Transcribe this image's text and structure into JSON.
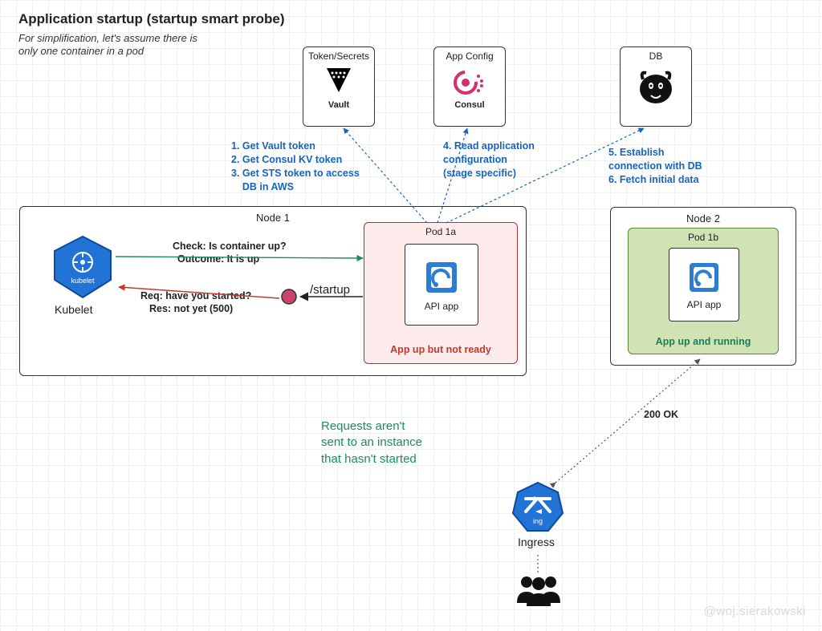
{
  "title": "Application startup (startup smart probe)",
  "subtitle_l1": "For simplification, let's assume there is",
  "subtitle_l2": "only one container in a pod",
  "services": {
    "vault": {
      "title": "Token/Secrets",
      "name": "Vault"
    },
    "consul": {
      "title": "App Config",
      "name": "Consul"
    },
    "db": {
      "title": "DB",
      "name": "PostgreSQL"
    }
  },
  "steps": {
    "vault": [
      "1. Get Vault token",
      "2. Get Consul KV token",
      "3. Get STS token to access",
      "    DB in AWS"
    ],
    "consul": [
      "4. Read application",
      "configuration",
      "(stage specific)"
    ],
    "db": [
      "5. Establish",
      "connection with DB",
      "6. Fetch initial data"
    ]
  },
  "node1": {
    "label": "Node 1",
    "kubelet": "Kubelet",
    "kubelet_badge": "kubelet",
    "check_l1": "Check: Is container up?",
    "check_l2": "Outcome: It is up",
    "probe_l1": "Req: have you started?",
    "probe_l2": "Res: not yet (500)",
    "endpoint": "/startup",
    "pod": {
      "title": "Pod 1a",
      "app": "API app",
      "status": "App up but not ready"
    }
  },
  "node2": {
    "label": "Node 2",
    "pod": {
      "title": "Pod 1b",
      "app": "API app",
      "status": "App up and running"
    }
  },
  "ingress": {
    "label": "Ingress",
    "badge": "ing",
    "response": "200 OK"
  },
  "message_l1": "Requests aren't",
  "message_l2": "sent to an instance",
  "message_l3": "that hasn't started",
  "watermark": "@woj.sierakowski"
}
